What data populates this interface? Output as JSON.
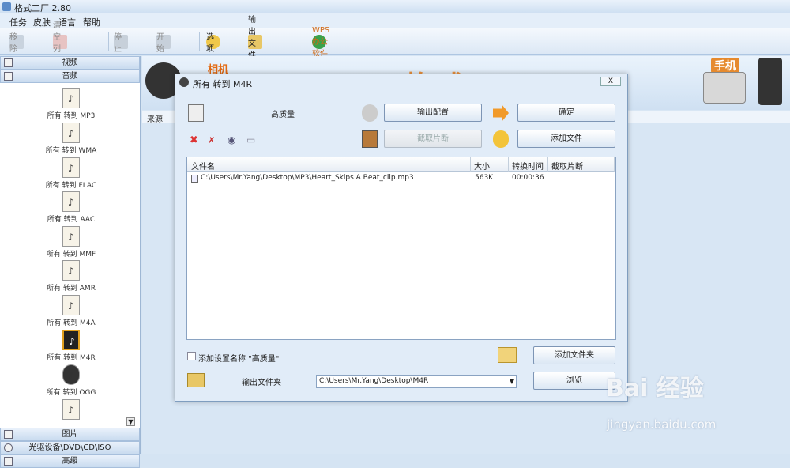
{
  "window": {
    "title": "格式工厂 2.80"
  },
  "menu": [
    "任务",
    "皮肤",
    "语言",
    "帮助"
  ],
  "toolbar": {
    "remove": "移除",
    "clear_list": "清空列表",
    "stop": "停止",
    "start": "开始",
    "options": "选项",
    "output_folder": "输出文件夹",
    "wps": "WPS办公软件"
  },
  "sidebar": {
    "categories_top": [
      "视频",
      "音频"
    ],
    "items": [
      {
        "label": "所有 转到 MP3",
        "badge": "MP3"
      },
      {
        "label": "所有 转到 WMA",
        "badge": "WMA"
      },
      {
        "label": "所有 转到 FLAC",
        "badge": "Flac"
      },
      {
        "label": "所有 转到 AAC",
        "badge": "AAC"
      },
      {
        "label": "所有 转到 MMF",
        "badge": "MMF"
      },
      {
        "label": "所有 转到 AMR",
        "badge": "AMR"
      },
      {
        "label": "所有 转到 M4A",
        "badge": "M4A"
      },
      {
        "label": "所有 转到 M4R",
        "badge": "M4R"
      },
      {
        "label": "所有 转到 OGG",
        "badge": "OGG"
      }
    ],
    "categories_bottom": [
      "图片",
      "光驱设备\\DVD\\CD\\ISO",
      "高级"
    ]
  },
  "banner": {
    "brand": "格式工厂",
    "camera": "相机",
    "phone": "手机"
  },
  "main": {
    "column_source": "来源"
  },
  "dialog": {
    "title": "所有 转到 M4R",
    "close": "X",
    "quality": "高质量",
    "output_config": "输出配置",
    "ok": "确定",
    "clip": "截取片断",
    "add_file": "添加文件",
    "columns": [
      "文件名",
      "大小",
      "转换时间",
      "截取片断"
    ],
    "files": [
      {
        "name": "C:\\Users\\Mr.Yang\\Desktop\\MP3\\Heart_Skips A Beat_clip.mp3",
        "size": "563K",
        "time": "00:00:36",
        "clip": ""
      }
    ],
    "append_setting": "添加设置名称 \"高质量\"",
    "add_folder": "添加文件夹",
    "output_folder_label": "输出文件夹",
    "output_path": "C:\\Users\\Mr.Yang\\Desktop\\M4R",
    "browse": "浏览"
  },
  "watermark": {
    "logo": "Bai 经验",
    "url": "jingyan.baidu.com"
  }
}
